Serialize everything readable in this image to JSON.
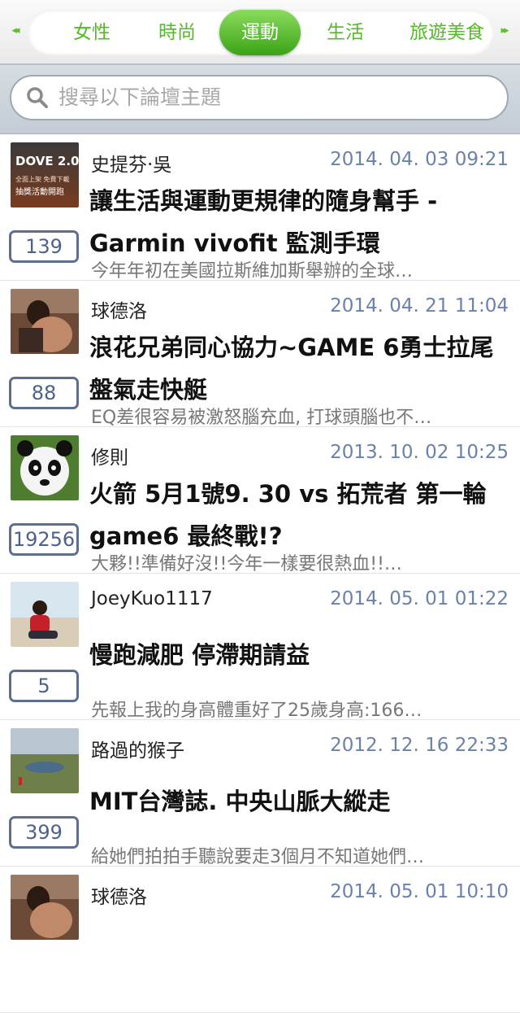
{
  "tabs": {
    "left_arrow": "◂◂",
    "right_arrow": "▸▸",
    "items": [
      {
        "label": "女性",
        "active": false
      },
      {
        "label": "時尚",
        "active": false
      },
      {
        "label": "運動",
        "active": true
      },
      {
        "label": "生活",
        "active": false
      },
      {
        "label": "旅遊美食",
        "active": false
      }
    ]
  },
  "search": {
    "placeholder": "搜尋以下論壇主題"
  },
  "threads": [
    {
      "author": "史提芬‧吳",
      "date": "2014. 04. 03 09:21",
      "title": "讓生活與運動更規律的隨身幫手 - Garmin vivofit 監測手環",
      "snippet": "今年年初在美國拉斯維加斯舉辦的全球…",
      "count": "139",
      "thumb": "dove-promo",
      "thumb_text": [
        "DOVE 2.0",
        "全面上架 免費下載",
        "抽獎活動開跑"
      ]
    },
    {
      "author": "球德洛",
      "date": "2014. 04. 21 11:04",
      "title": "浪花兄弟同心協力~GAME 6勇士拉尾盤氣走快艇",
      "snippet": "EQ差很容易被激怒腦充血, 打球頭腦也不…",
      "count": "88",
      "thumb": "person-photo"
    },
    {
      "author": "修則",
      "date": "2013. 10. 02 10:25",
      "title": "火箭 5月1號9. 30 vs 拓荒者 第一輪game6 最終戰!?",
      "snippet": "大夥!!準備好沒!!今年一樣要很熱血!!…",
      "count": "19256",
      "thumb": "panda"
    },
    {
      "author": "JoeyKuo1117",
      "date": "2014. 05. 01 01:22",
      "title": "慢跑減肥  停滯期請益",
      "snippet": "先報上我的身高體重好了25歲身高:166…",
      "count": "5",
      "thumb": "beach-person"
    },
    {
      "author": "路過的猴子",
      "date": "2012. 12. 16 22:33",
      "title": "MIT台灣誌. 中央山脈大縱走",
      "snippet": "給她們拍拍手聽說要走3個月不知道她們…",
      "count": "399",
      "thumb": "mountain-lake"
    },
    {
      "author": "球德洛",
      "date": "2014. 05. 01 10:10",
      "title": "",
      "snippet": "",
      "count": "",
      "thumb": "person-photo"
    }
  ],
  "colors": {
    "accent_green": "#56b82a",
    "active_tab": "#3aa315",
    "count_border": "#5c6f90",
    "date_text": "#6b82a8"
  }
}
